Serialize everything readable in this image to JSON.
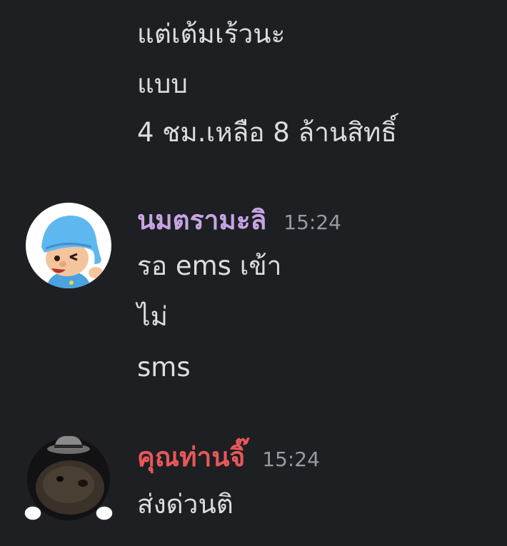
{
  "theme": {
    "background": "#1e1f22",
    "text": "#dcdde0",
    "muted": "#949ba4",
    "user1_color": "#c7a4e6",
    "user2_color": "#e8585a"
  },
  "messages_top": [
    "แต่เต้มเร้วนะ",
    "แบบ",
    "4 ชม.เหลือ 8 ล้านสิทธิ์"
  ],
  "groups": [
    {
      "author": "นมตรามะลิ",
      "time": "15:24",
      "avatar_icon": "cartoon-boy-blue-hat-icon",
      "lines": [
        "รอ ems เข้า",
        "ไม่",
        "sms"
      ]
    },
    {
      "author": "คุณท่านจิ๊",
      "time": "15:24",
      "avatar_icon": "hamster-fedora-icon",
      "lines": [
        "ส่งด่วนติ"
      ]
    }
  ]
}
